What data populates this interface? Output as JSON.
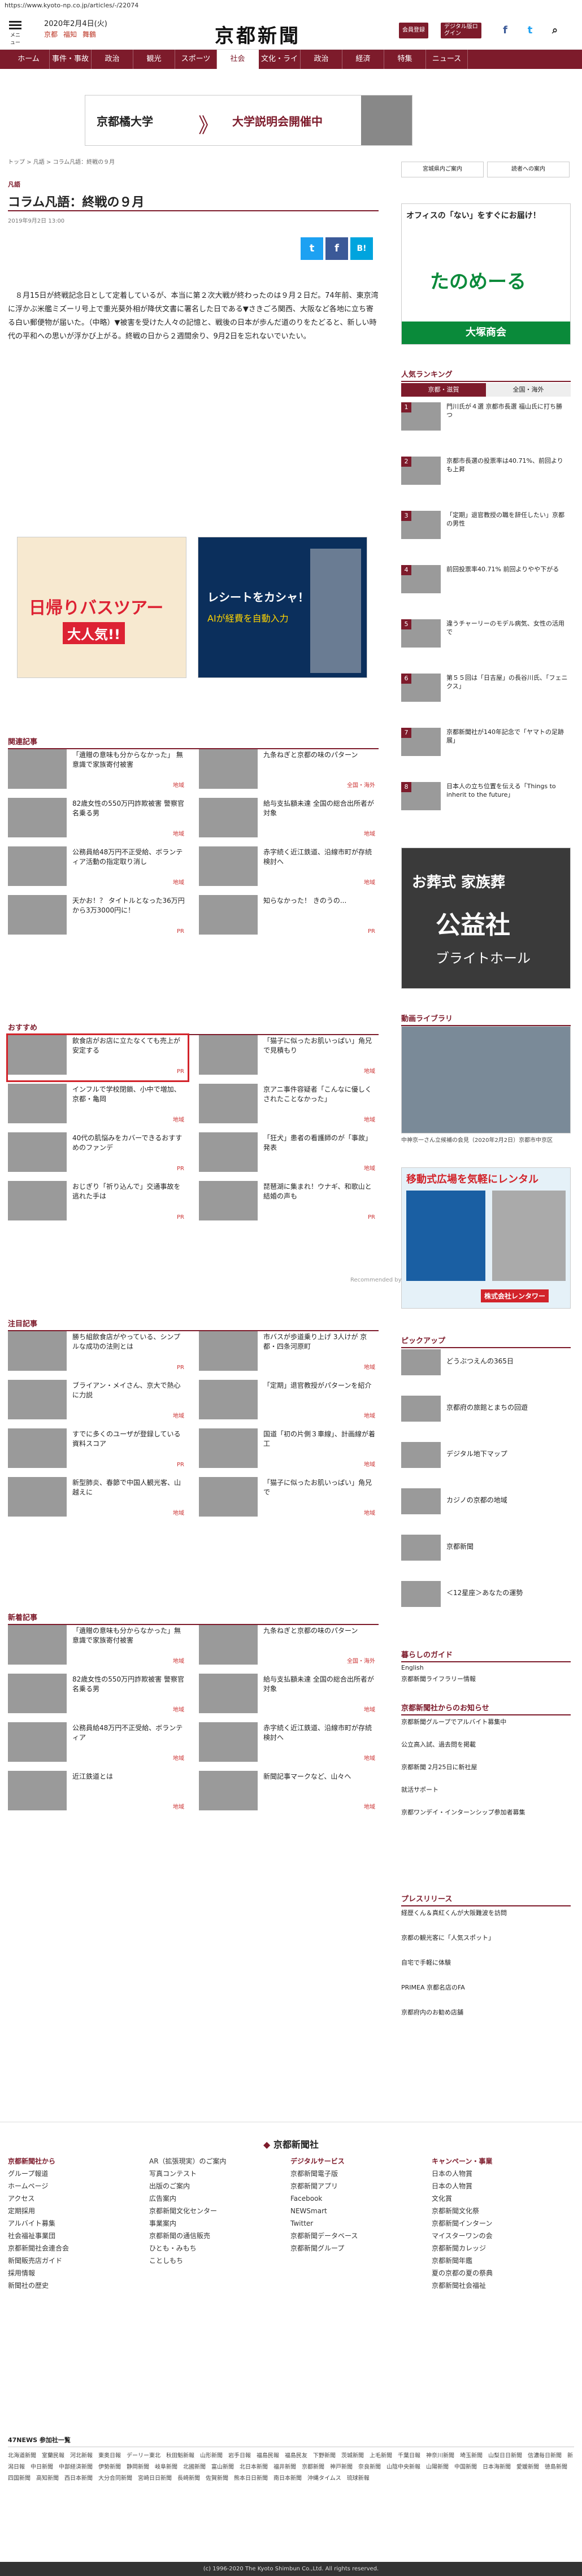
{
  "browser": {
    "url": "https://www.kyoto-np.co.jp/articles/-/22074"
  },
  "header": {
    "menu_label": "メニュー",
    "date": "2020年2月4日(火)",
    "weather": [
      "京都",
      "福知",
      "舞鶴",
      "久御"
    ],
    "logo": "京都新聞",
    "btn_member": "会員登録",
    "btn_digital": "デジタル版ログイン",
    "social": [
      "f",
      "t",
      "facebook-icon",
      "twitter-icon"
    ]
  },
  "nav": [
    "ホーム",
    "事件・事故",
    "政治",
    "観光",
    "スポーツ",
    "社会",
    "文化・ライフ",
    "政治",
    "経済",
    "特集",
    "ニュース"
  ],
  "ad_top": {
    "brand": "京都橘大学",
    "text": "大学説明会開催中"
  },
  "breadcrumb": "トップ > 凡語 > コラム凡語：終戦の９月",
  "section": "凡語",
  "article": {
    "title": "コラム凡語：終戦の９月",
    "date": "2019年9月2日 13:00",
    "body": "８月15日が終戦記念日として定着しているが、本当に第２次大戦が終わったのは９月２日だ。74年前、東京湾に浮かぶ米艦ミズーリ号上で重光葵外相が降伏文書に署名した日である▼さきごろ関西、大阪など各地に立ち寄る白い郵便物が届いた。（中略）▼被害を受けた人々の記憶と、戦後の日本が歩んだ道のりをたどると、新しい時代の平和への思いが浮かび上がる。終戦の日から２週間余り、9月2日を忘れないでいたい。"
  },
  "share": {
    "twitter": "t",
    "facebook": "f",
    "hatena": "B!"
  },
  "ad_mid": [
    {
      "title": "日帰りバスツアー",
      "sub": "大人気!!"
    },
    {
      "title": "レシートをカシャ！",
      "sub": "AIが経費を自動入力"
    }
  ],
  "related": {
    "heading": "関連記事",
    "items": [
      {
        "text": "「遺贈の意味も分からなかった」 無意識で家族寄付被害",
        "cat": "地域"
      },
      {
        "text": "九条ねぎと京都の味のパターン",
        "cat": "全国・海外"
      },
      {
        "text": "82歳女性の550万円詐欺被害 警察官名乗る男",
        "cat": "地域"
      },
      {
        "text": "給与支払額未達 全国の総合出所者が対象",
        "cat": "地域"
      },
      {
        "text": "公務員給48万円不正受給、ボランティア活動の指定取り消し",
        "cat": "地域"
      },
      {
        "text": "赤字続く近江鉄道、沿線市町が存続検討へ",
        "cat": "地域"
      },
      {
        "text": "天かお！？ タイトルとなった36万円から3万3000円に！",
        "cat": "PR"
      },
      {
        "text": "知らなかった！ きのうの...",
        "cat": "PR"
      }
    ]
  },
  "recommend": {
    "heading": "おすすめ",
    "items": [
      {
        "text": "飲食店がお店に立たなくても売上が安定する",
        "cat": "PR"
      },
      {
        "text": "「猫子に似ったお肌いっぱい」角兄で見積もり",
        "cat": "地域"
      },
      {
        "text": "インフルで学校閉鎖、小中で増加、京都・亀岡",
        "cat": "地域"
      },
      {
        "text": "京アニ事件容疑者「こんなに優しくされたことなかった」",
        "cat": "地域"
      },
      {
        "text": "40代の肌悩みをカバーできるおすすめのファンデ",
        "cat": "PR"
      },
      {
        "text": "「狂犬」患者の看護師のが「事故」発表",
        "cat": "地域"
      },
      {
        "text": "おじぎり「祈り込んで」交通事故を逃れた手は",
        "cat": "PR"
      },
      {
        "text": "琵琶湖に集まれ！ウナギ、和歌山と結婚の声も",
        "cat": "PR"
      }
    ]
  },
  "notable": {
    "heading": "注目記事",
    "items": [
      {
        "text": "勝ち組飲食店がやっている、シンプルな成功の法則とは",
        "cat": "PR"
      },
      {
        "text": "市バスが歩道乗り上げ 3人けが 京都・四条河原町",
        "cat": "地域"
      },
      {
        "text": "ブライアン・メイさん、京大で熱心に力説",
        "cat": "地域"
      },
      {
        "text": "「定期」退官教授がパターンを紹介",
        "cat": "地域"
      },
      {
        "text": "すでに多くのユーザが登録している資料スコア",
        "cat": "PR"
      },
      {
        "text": "国道「初の片側３車線」、計画線が着工",
        "cat": "地域"
      },
      {
        "text": "新型肺炎、春節で中国人観光客、山越えに",
        "cat": "地域"
      },
      {
        "text": "「猫子に似ったお肌いっぱい」角兄で",
        "cat": "地域"
      }
    ]
  },
  "newest": {
    "heading": "新着記事",
    "items": [
      {
        "text": "「遺贈の意味も分からなかった」無意識で家族寄付被害",
        "cat": "地域"
      },
      {
        "text": "九条ねぎと京都の味のパターン",
        "cat": "全国・海外"
      },
      {
        "text": "82歳女性の550万円詐欺被害 警察官名乗る男",
        "cat": "地域"
      },
      {
        "text": "給与支払額未達 全国の総合出所者が対象",
        "cat": "地域"
      },
      {
        "text": "公務員給48万円不正受給、ボランティア",
        "cat": "地域"
      },
      {
        "text": "赤字続く近江鉄道、沿線市町が存続検討へ",
        "cat": "地域"
      },
      {
        "text": "近江鉄道とは",
        "cat": "地域"
      },
      {
        "text": "新聞記事マークなど、山々へ",
        "cat": "地域"
      }
    ]
  },
  "side": {
    "ad1": {
      "title": "オフィスの「ない」をすぐにお届け！",
      "brand": "たのめーる",
      "sub": "大塚商会"
    },
    "ranking_heading": "人気ランキング",
    "ranking_tabs": [
      "京都・滋賀",
      "全国・海外"
    ],
    "ranking": [
      {
        "n": "1",
        "text": "門川氏が４選 京都市長選 福山氏に打ち勝つ"
      },
      {
        "n": "2",
        "text": "京都市長選の投票率は40.71%、前回よりも上昇"
      },
      {
        "n": "3",
        "text": "「定期」退官教授の職を辞任したい」京都の男性"
      },
      {
        "n": "4",
        "text": "前回投票率40.71% 前回よりやや下がる"
      },
      {
        "n": "5",
        "text": "違うチャーリーのモデル病気、女性の活用で"
      },
      {
        "n": "6",
        "text": "第５５回は「日吉屋」の長谷川氏、「フェニクス」"
      },
      {
        "n": "7",
        "text": "京都新聞社が140年記念で「ヤマトの足跡展」"
      },
      {
        "n": "8",
        "text": "日本人の立ち位置を伝える「Things to inherit to the future」"
      }
    ],
    "ad2": {
      "title": "お葬式 家族葬",
      "brand": "公益社",
      "sub": "ブライトホール"
    },
    "photo_heading": "動画ライブラリ",
    "photo_caption": "中神京一さん立候補の会見（2020年2月2日）京都市中京区",
    "ad3": {
      "title": "移動式広場を気軽にレンタル",
      "brand": "株式会社レンタワー"
    },
    "pickup_heading": "ピックアップ",
    "pickup": [
      "どうぶつえんの365日",
      "京都府の旅館とまちの回遊",
      "デジタル地下マップ",
      "カジノの京都の地域",
      "京都新聞",
      "＜12星座＞あなたの運勢"
    ],
    "guide_heading": "暮らしのガイド",
    "guide": [
      "English",
      "京都新聞ライフラリー情報"
    ],
    "notice_heading": "京都新聞社からのお知らせ",
    "notice": [
      "京都新聞グループでアルバイト募集中",
      "公立高入試、過去問を掲載",
      "京都新聞 2月25日に新社屋",
      "就活サポート",
      "京都ワンデイ・インターンシップ参加者募集"
    ],
    "press_heading": "プレスリリース",
    "press": [
      "経歴くん＆真紅くんが大阪難波を訪問",
      "京都の観光客に「人気スポット」",
      "自宅で手軽に体験",
      "PRIMEA 京都名店のFA",
      "京都府内のお勧め店舗"
    ]
  },
  "footer_logo": "京都新聞社",
  "footer_cols": [
    {
      "h": "京都新聞社から",
      "items": [
        "グループ報道",
        "ホームページ",
        "アクセス",
        "定期採用",
        "アルバイト募集",
        "社会福祉事業団",
        "京都新聞社会連合会",
        "新聞販売店ガイド",
        "採用情報",
        "新聞社の歴史"
      ]
    },
    {
      "h": "",
      "items": [
        "AR（拡張現実）のご案内",
        "写真コンテスト",
        "出版のご案内",
        "広告案内",
        "京都新聞文化センター",
        "事業案内",
        "京都新聞の通信販売",
        "ひとも・みもち",
        "ことしもち"
      ]
    },
    {
      "h": "デジタルサービス",
      "items": [
        "京都新聞電子版",
        "京都新聞アプリ",
        "Facebook",
        "NEWSmart",
        "Twitter",
        "京都新聞データベース",
        "京都新聞グループ"
      ]
    },
    {
      "h": "キャンペーン・事業",
      "items": [
        "日本の人物賞",
        "日本の人物賞",
        "文化賞",
        "京都新聞文化祭",
        "京都新聞インターン",
        "マイスターワンの会",
        "京都新聞カレッジ",
        "京都新聞年鑑",
        "夏の京都の夏の祭典",
        "京都新聞社会福祉"
      ]
    }
  ],
  "news_partners": {
    "heading": "47NEWS 参加社一覧",
    "list": [
      "北海道新聞",
      "室蘭民報",
      "河北新報",
      "東奥日報",
      "デーリー東北",
      "秋田魁新報",
      "山形新聞",
      "岩手日報",
      "福島民報",
      "福島民友",
      "下野新聞",
      "茨城新聞",
      "上毛新聞",
      "千葉日報",
      "神奈川新聞",
      "埼玉新聞",
      "山梨日日新聞",
      "信濃毎日新聞",
      "新潟日報",
      "中日新聞",
      "中部経済新聞",
      "伊勢新聞",
      "静岡新聞",
      "岐阜新聞",
      "北國新聞",
      "富山新聞",
      "北日本新聞",
      "福井新聞",
      "京都新聞",
      "神戸新聞",
      "奈良新聞",
      "山陰中央新報",
      "山陽新聞",
      "中国新聞",
      "日本海新聞",
      "愛媛新聞",
      "徳島新聞",
      "四国新聞",
      "高知新聞",
      "西日本新聞",
      "大分合同新聞",
      "宮崎日日新聞",
      "長崎新聞",
      "佐賀新聞",
      "熊本日日新聞",
      "南日本新聞",
      "沖縄タイムス",
      "琉球新報"
    ]
  },
  "copyright": "(c) 1996-2020 The Kyoto Shimbun Co.,Ltd. All rights reserved.",
  "colors": {
    "brand": "#7d1b2b",
    "twitter": "#1da1f2",
    "facebook": "#3b5998",
    "hatena": "#00a4de"
  }
}
